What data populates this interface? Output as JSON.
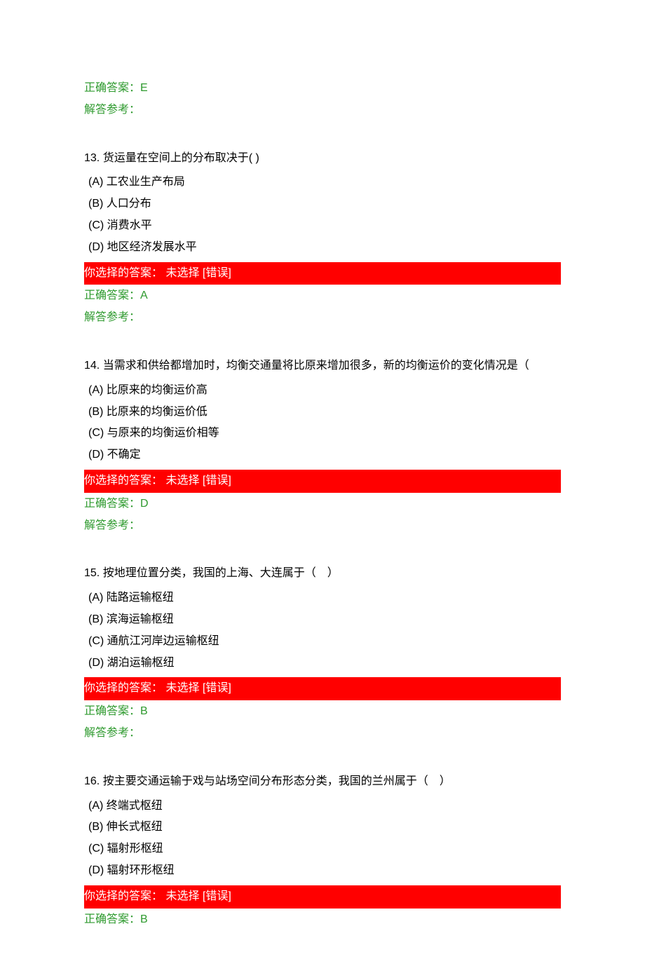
{
  "labels": {
    "correct_prefix": "正确答案：",
    "explain_prefix": "解答参考：",
    "your_choice_prefix": "你选择的答案：",
    "not_selected": " 未选择 ",
    "wrong_tag": "[错误]"
  },
  "pre": {
    "correct": "E",
    "explain": ""
  },
  "questions": [
    {
      "number": "13.",
      "text": "货运量在空间上的分布取决于( )",
      "options": [
        "(A) 工农业生产布局",
        "(B) 人口分布",
        "(C) 消费水平",
        "(D) 地区经济发展水平"
      ],
      "correct": "A",
      "explain": ""
    },
    {
      "number": "14.",
      "text": "当需求和供给都增加时，均衡交通量将比原来增加很多，新的均衡运价的变化情况是（",
      "options": [
        "(A) 比原来的均衡运价高",
        "(B) 比原来的均衡运价低",
        "(C) 与原来的均衡运价相等",
        "(D) 不确定"
      ],
      "correct": "D",
      "explain": ""
    },
    {
      "number": "15.",
      "text": "按地理位置分类，我国的上海、大连属于（　）",
      "options": [
        "(A) 陆路运输枢纽",
        "(B) 滨海运输枢纽",
        "(C) 通航江河岸边运输枢纽",
        "(D) 湖泊运输枢纽"
      ],
      "correct": "B",
      "explain": ""
    },
    {
      "number": "16.",
      "text": "按主要交通运输于戏与站场空间分布形态分类，我国的兰州属于（　）",
      "options": [
        "(A) 终端式枢纽",
        "(B) 伸长式枢纽",
        "(C) 辐射形枢纽",
        "(D) 辐射环形枢纽"
      ],
      "correct": "B",
      "explain": ""
    }
  ]
}
